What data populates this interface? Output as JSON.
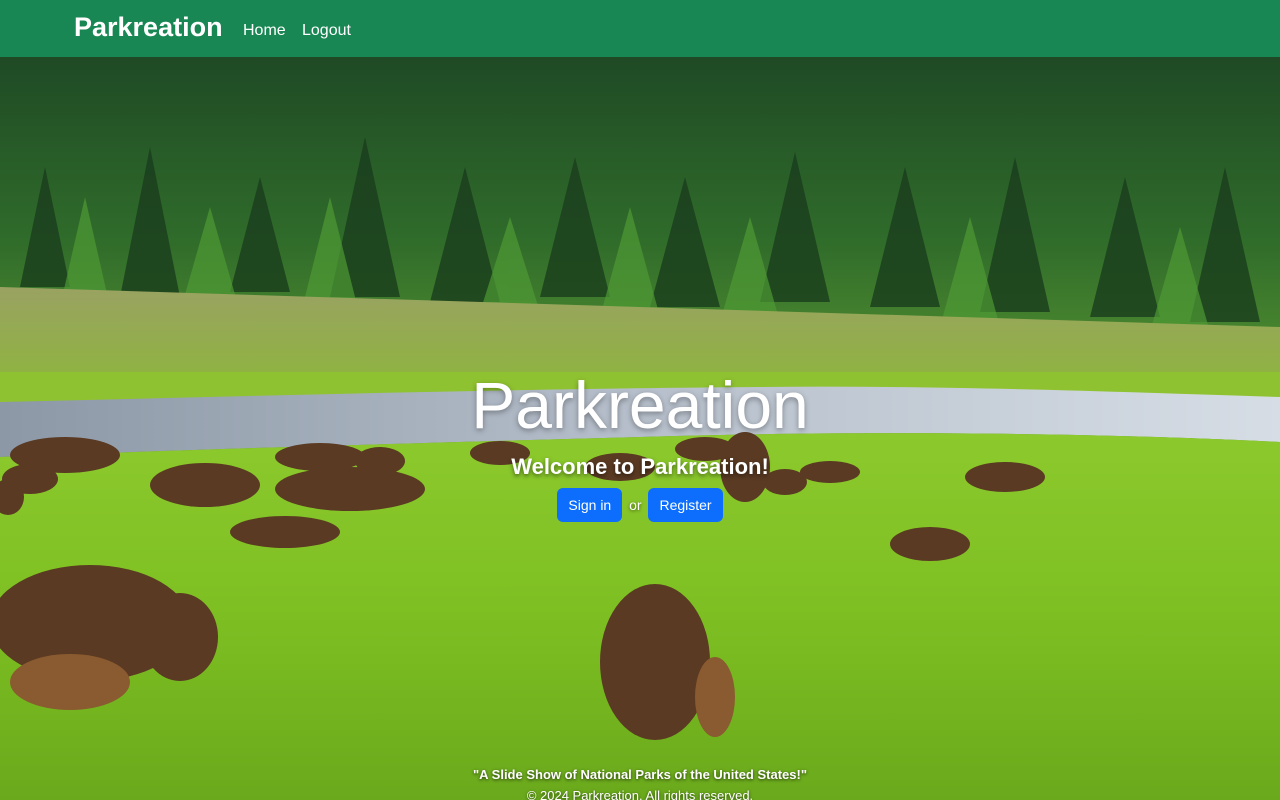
{
  "navbar": {
    "brand": "Parkreation",
    "links": [
      {
        "label": "Home"
      },
      {
        "label": "Logout"
      }
    ]
  },
  "hero": {
    "title": "Parkreation",
    "subtitle": "Welcome to Parkreation!",
    "signin_label": "Sign in",
    "or_text": "or",
    "register_label": "Register"
  },
  "footer": {
    "quote": "\"A Slide Show of National Parks of the United States!\"",
    "copyright": "© 2024 Parkreation. All rights reserved."
  },
  "colors": {
    "navbar": "#198754",
    "button": "#0d6efd"
  }
}
